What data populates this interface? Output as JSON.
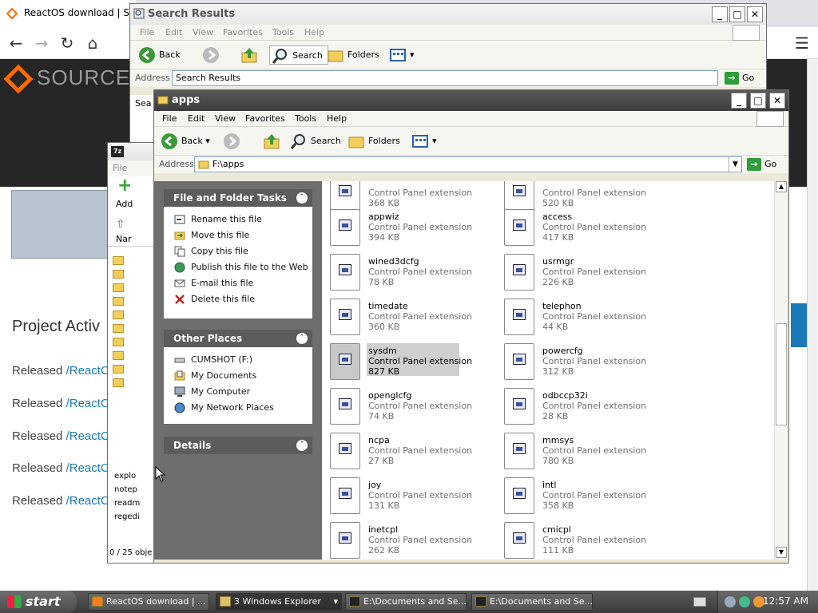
{
  "browser": {
    "tab_title": "ReactOS download | Source",
    "logo_text": "SOURCEF",
    "project_activity": "Project Activ",
    "released_rows": [
      {
        "label": "Released",
        "link": "/ReactC"
      },
      {
        "label": "Released",
        "link": "/ReactC"
      },
      {
        "label": "Released",
        "link": "/ReactC"
      },
      {
        "label": "Released",
        "link": "/ReactC"
      },
      {
        "label": "Released",
        "link": "/ReactC"
      }
    ]
  },
  "search_window": {
    "title": "Search Results",
    "menu": [
      "File",
      "Edit",
      "View",
      "Favorites",
      "Tools",
      "Help"
    ],
    "toolbar": {
      "back": "Back",
      "search": "Search",
      "folders": "Folders"
    },
    "address_label": "Address",
    "address_value": "Search Results",
    "go": "Go",
    "left_text": "Sea"
  },
  "sevenz_window": {
    "menu_first": "File",
    "add_label": "Add",
    "name_header": "Nar",
    "files": [
      "explo",
      "notep",
      "readm",
      "regedi"
    ],
    "status": "0 / 25 obje"
  },
  "apps_window": {
    "title": "apps",
    "menu": [
      "File",
      "Edit",
      "View",
      "Favorites",
      "Tools",
      "Help"
    ],
    "toolbar": {
      "back": "Back",
      "search": "Search",
      "folders": "Folders"
    },
    "address_label": "Address",
    "address_value": "F:\\apps",
    "go": "Go",
    "tasks": {
      "title": "File and Folder Tasks",
      "items": [
        "Rename this file",
        "Move this file",
        "Copy this file",
        "Publish this file to the Web",
        "E-mail this file",
        "Delete this file"
      ]
    },
    "other_places": {
      "title": "Other Places",
      "items": [
        "CUMSHOT (F:)",
        "My Documents",
        "My Computer",
        "My Network Places"
      ]
    },
    "details": {
      "title": "Details"
    },
    "files": [
      {
        "name": "",
        "type": "Control Panel extension",
        "size": "368 KB"
      },
      {
        "name": "",
        "type": "Control Panel extension",
        "size": "520 KB"
      },
      {
        "name": "appwiz",
        "type": "Control Panel extension",
        "size": "394 KB"
      },
      {
        "name": "access",
        "type": "Control Panel extension",
        "size": "417 KB"
      },
      {
        "name": "wined3dcfg",
        "type": "Control Panel extension",
        "size": "78 KB"
      },
      {
        "name": "usrmgr",
        "type": "Control Panel extension",
        "size": "226 KB"
      },
      {
        "name": "timedate",
        "type": "Control Panel extension",
        "size": "360 KB"
      },
      {
        "name": "telephon",
        "type": "Control Panel extension",
        "size": "44 KB"
      },
      {
        "name": "sysdm",
        "type": "Control Panel extension",
        "size": "827 KB",
        "selected": true
      },
      {
        "name": "powercfg",
        "type": "Control Panel extension",
        "size": "312 KB"
      },
      {
        "name": "openglcfg",
        "type": "Control Panel extension",
        "size": "74 KB"
      },
      {
        "name": "odbccp32i",
        "type": "Control Panel extension",
        "size": "28 KB"
      },
      {
        "name": "ncpa",
        "type": "Control Panel extension",
        "size": "27 KB"
      },
      {
        "name": "mmsys",
        "type": "Control Panel extension",
        "size": "780 KB"
      },
      {
        "name": "joy",
        "type": "Control Panel extension",
        "size": "131 KB"
      },
      {
        "name": "intl",
        "type": "Control Panel extension",
        "size": "358 KB"
      },
      {
        "name": "inetcpl",
        "type": "Control Panel extension",
        "size": "262 KB"
      },
      {
        "name": "cmicpl",
        "type": "Control Panel extension",
        "size": "111 KB"
      }
    ]
  },
  "taskbar": {
    "start": "start",
    "items": [
      "ReactOS download | ...",
      "3 Windows Explorer",
      "E:\\Documents and Se...",
      "E:\\Documents and Se..."
    ],
    "clock": "12:57 AM"
  }
}
